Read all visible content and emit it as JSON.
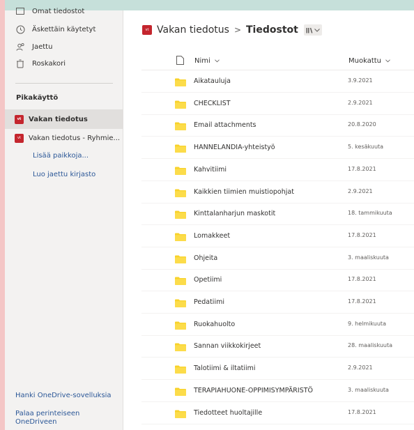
{
  "sidebar": {
    "nav": [
      {
        "label": "Omat tiedostot",
        "icon": "files-icon"
      },
      {
        "label": "Äskettäin käytetyt",
        "icon": "recent-icon"
      },
      {
        "label": "Jaettu",
        "icon": "shared-icon"
      },
      {
        "label": "Roskakori",
        "icon": "recycle-bin-icon"
      }
    ],
    "quick_title": "Pikakäyttö",
    "quick_items": [
      {
        "label": "Vakan tiedotus",
        "badge": "vt"
      },
      {
        "label": "Vakan tiedotus - Ryhmie...",
        "badge": "vt"
      }
    ],
    "more_places": "Lisää paikkoja...",
    "create_library": "Luo jaettu kirjasto",
    "get_apps": "Hanki OneDrive-sovelluksia",
    "classic_line1": "Palaa perinteiseen",
    "classic_line2": "OneDriveen"
  },
  "breadcrumb": {
    "badge": "vt",
    "root": "Vakan tiedotus",
    "separator": ">",
    "current": "Tiedostot"
  },
  "table": {
    "col_name": "Nimi",
    "col_modified": "Muokattu",
    "rows": [
      {
        "name": "Aikatauluja",
        "modified": "3.9.2021"
      },
      {
        "name": "CHECKLIST",
        "modified": "2.9.2021"
      },
      {
        "name": "Email attachments",
        "modified": "20.8.2020"
      },
      {
        "name": "HANNELANDIA-yhteistyö",
        "modified": "5. kesäkuuta"
      },
      {
        "name": "Kahvitiimi",
        "modified": "17.8.2021"
      },
      {
        "name": "Kaikkien tiimien muistiopohjat",
        "modified": "2.9.2021"
      },
      {
        "name": "Kinttalanharjun maskotit",
        "modified": "18. tammikuuta"
      },
      {
        "name": "Lomakkeet",
        "modified": "17.8.2021"
      },
      {
        "name": "Ohjeita",
        "modified": "3. maaliskuuta"
      },
      {
        "name": "Opetiimi",
        "modified": "17.8.2021"
      },
      {
        "name": "Pedatiimi",
        "modified": "17.8.2021"
      },
      {
        "name": "Ruokahuolto",
        "modified": "9. helmikuuta"
      },
      {
        "name": "Sannan viikkokirjeet",
        "modified": "28. maaliskuuta"
      },
      {
        "name": "Talotiimi & iltatiimi",
        "modified": "2.9.2021"
      },
      {
        "name": "TERAPIAHUONE-OPPIMISYMPÄRISTÖ",
        "modified": "3. maaliskuuta"
      },
      {
        "name": "Tiedotteet huoltajille",
        "modified": "17.8.2021"
      }
    ]
  },
  "colors": {
    "accent_red": "#c4262e",
    "folder_yellow": "#f8d22a",
    "link_blue": "#2b5797",
    "top_band": "#c6e0da",
    "left_band": "#f4c6c6"
  }
}
